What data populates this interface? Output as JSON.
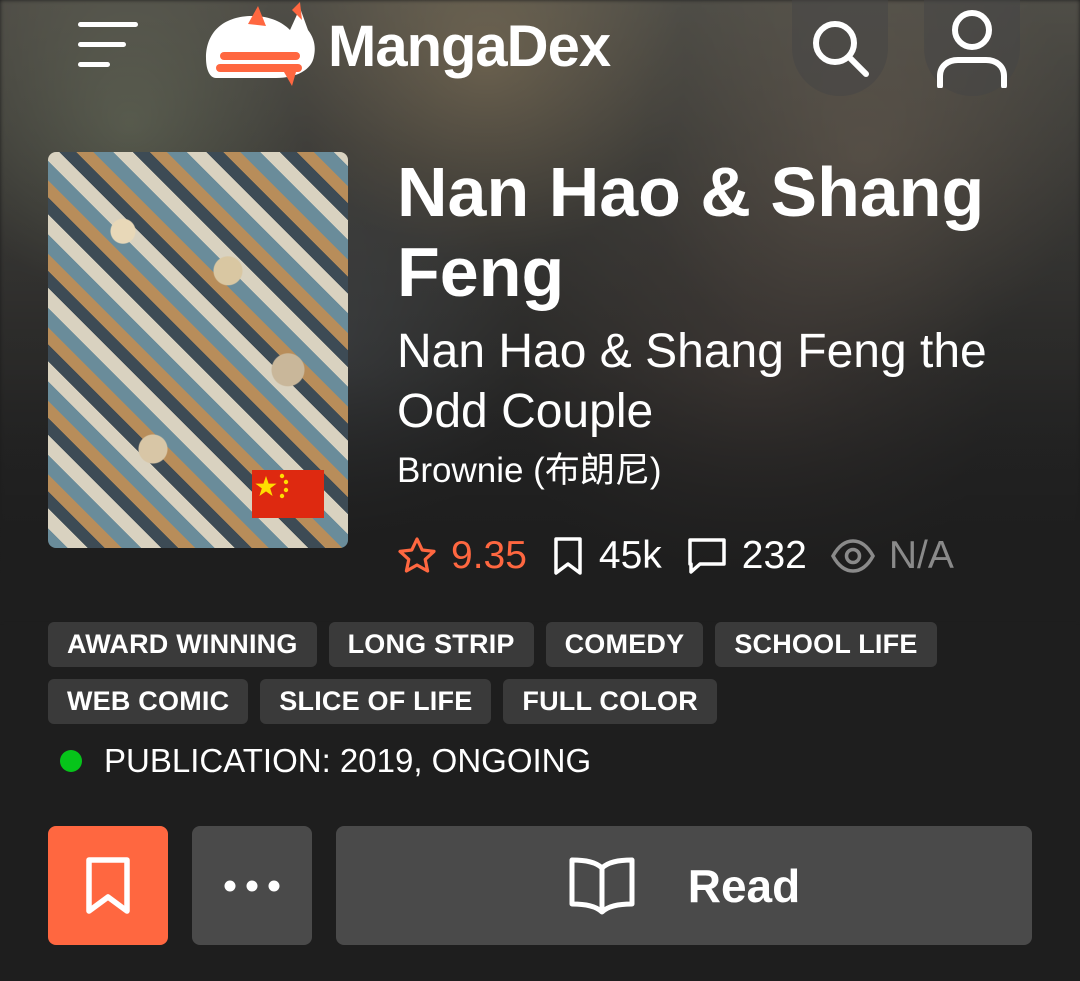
{
  "navbar": {
    "logo_text": "MangaDex",
    "icons": {
      "menu": "menu-icon",
      "logo": "mangadex-cat-logo",
      "search": "search-icon",
      "user": "user-icon"
    }
  },
  "manga": {
    "title": "Nan Hao & Shang Feng",
    "alt_title": "Nan Hao & Shang Feng the Odd Couple",
    "author": "Brownie (布朗尼)",
    "cover_country_flag": "china-flag",
    "stats": {
      "rating": "9.35",
      "follows": "45k",
      "comments": "232",
      "views": "N/A"
    },
    "tags": [
      [
        "AWARD WINNING",
        "LONG STRIP",
        "COMEDY",
        "SCHOOL LIFE"
      ],
      [
        "WEB COMIC",
        "SLICE OF LIFE",
        "FULL COLOR"
      ]
    ],
    "publication": "PUBLICATION: 2019, ONGOING",
    "publication_status_color": "#06c41a"
  },
  "actions": {
    "follow_icon": "bookmark-icon",
    "more_icon": "more-dots-icon",
    "read_icon": "open-book-icon",
    "read_label": "Read"
  },
  "colors": {
    "accent": "#ff6740",
    "button_bg": "#4a4a4a",
    "tag_bg": "#3a3a3a",
    "page_bg": "#1e1e1e"
  }
}
